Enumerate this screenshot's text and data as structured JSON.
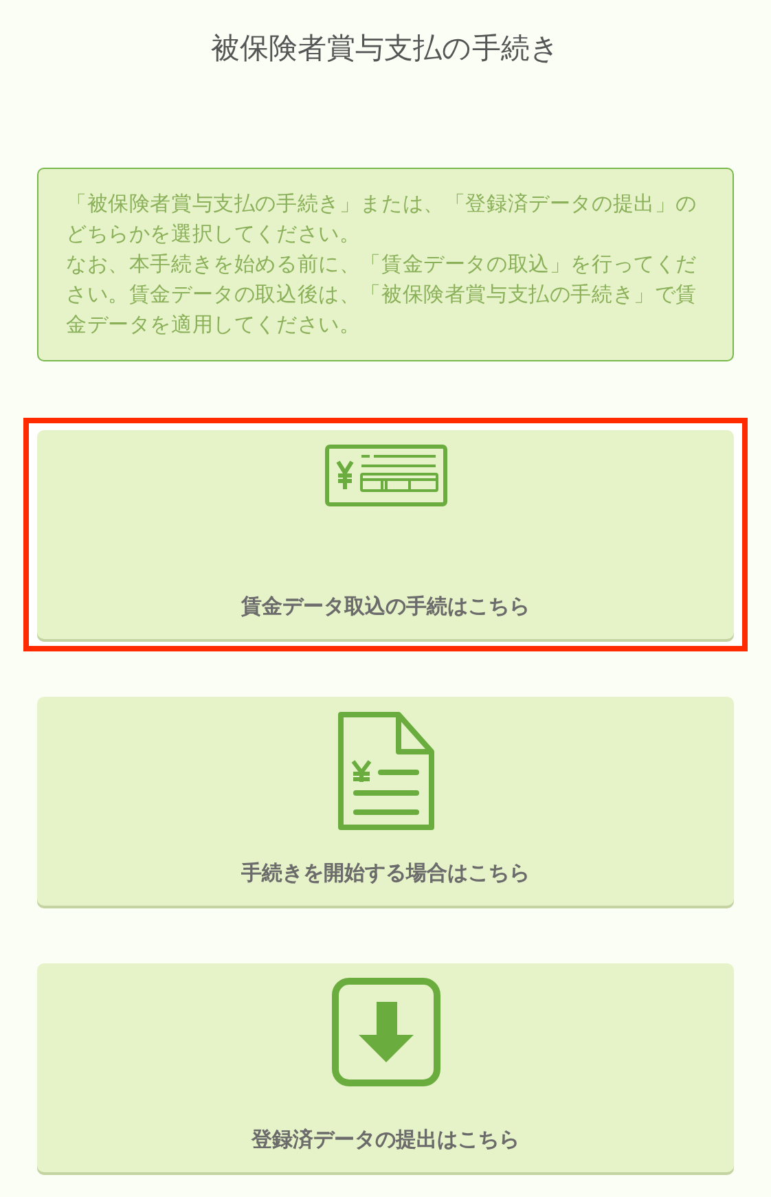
{
  "title": "被保険者賞与支払の手続き",
  "notice": {
    "paragraphs": [
      "「被保険者賞与支払の手続き」または、「登録済データの提出」のどちらかを選択してください。",
      "なお、本手続きを始める前に、「賃金データの取込」を行ってください。賃金データの取込後は、「被保険者賞与支払の手続き」で賃金データを適用してください。"
    ]
  },
  "cards": [
    {
      "kind": "wage-slip",
      "label": "賃金データ取込の手続はこちら",
      "highlighted": true
    },
    {
      "kind": "document",
      "label": "手続きを開始する場合はこちら",
      "highlighted": false
    },
    {
      "kind": "download",
      "label": "登録済データの提出はこちら",
      "highlighted": false
    }
  ]
}
